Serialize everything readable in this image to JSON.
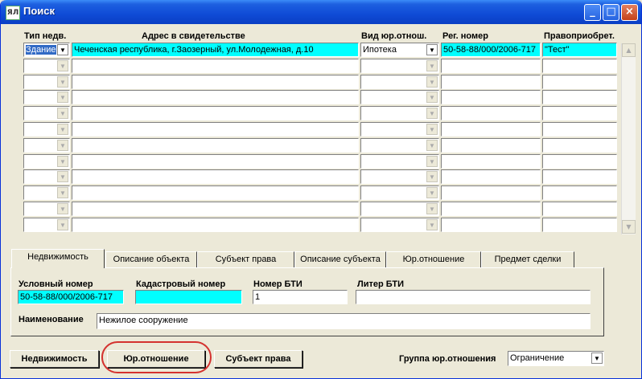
{
  "window": {
    "title": "Поиск",
    "icon": "app-icon",
    "controls": [
      "minimize-icon",
      "maximize-icon",
      "close-icon"
    ]
  },
  "grid": {
    "columns": [
      "Тип недв.",
      "Адрес в свидетельстве",
      "Вид юр.отнош.",
      "Рег. номер",
      "Правоприобрет."
    ],
    "rows": [
      {
        "type": "Здание",
        "address": "Чеченская республика, г.Заозерный, ул.Молодежная, д.10",
        "relation": "Ипотека",
        "reg": "50-58-88/000/2006-717",
        "acq": "\"Тест\""
      },
      {
        "type": "",
        "address": "",
        "relation": "",
        "reg": "",
        "acq": ""
      },
      {
        "type": "",
        "address": "",
        "relation": "",
        "reg": "",
        "acq": ""
      },
      {
        "type": "",
        "address": "",
        "relation": "",
        "reg": "",
        "acq": ""
      },
      {
        "type": "",
        "address": "",
        "relation": "",
        "reg": "",
        "acq": ""
      },
      {
        "type": "",
        "address": "",
        "relation": "",
        "reg": "",
        "acq": ""
      },
      {
        "type": "",
        "address": "",
        "relation": "",
        "reg": "",
        "acq": ""
      },
      {
        "type": "",
        "address": "",
        "relation": "",
        "reg": "",
        "acq": ""
      },
      {
        "type": "",
        "address": "",
        "relation": "",
        "reg": "",
        "acq": ""
      },
      {
        "type": "",
        "address": "",
        "relation": "",
        "reg": "",
        "acq": ""
      },
      {
        "type": "",
        "address": "",
        "relation": "",
        "reg": "",
        "acq": ""
      },
      {
        "type": "",
        "address": "",
        "relation": "",
        "reg": "",
        "acq": ""
      }
    ]
  },
  "tabs": [
    "Недвижимость",
    "Описание объекта",
    "Субъект права",
    "Описание субъекта",
    "Юр.отношение",
    "Предмет сделки"
  ],
  "form": {
    "cond_number_label": "Условный номер",
    "cond_number_value": "50-58-88/000/2006-717",
    "cadastral_label": "Кадастровый номер",
    "cadastral_value": "",
    "bti_number_label": "Номер БТИ",
    "bti_number_value": "1",
    "bti_letter_label": "Литер БТИ",
    "bti_letter_value": "",
    "name_label": "Наименование",
    "name_value": "Нежилое сооружение"
  },
  "buttons": {
    "property": "Недвижимость",
    "relation": "Юр.отношение",
    "subject": "Субъект права"
  },
  "group": {
    "label": "Группа юр.отношения",
    "value": "Ограничение"
  },
  "colors": {
    "highlight": "#00ffff",
    "title_bar": "#0f4bd6",
    "annotation_ring": "#d4322f"
  }
}
